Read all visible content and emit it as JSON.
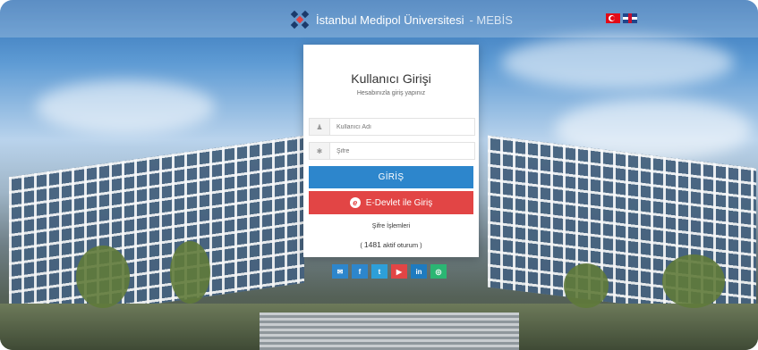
{
  "header": {
    "brand_name": "İstanbul Medipol Üniversitesi",
    "brand_suffix": "- MEBİS",
    "languages": [
      "tr-flag-icon",
      "en-flag-icon"
    ]
  },
  "login": {
    "title": "Kullanıcı Girişi",
    "subtitle": "Hesabınızla giriş yapınız",
    "username_placeholder": "Kullanıcı Adı",
    "password_placeholder": "Şifre",
    "login_button": "GİRİŞ",
    "edevlet_button": "E-Devlet ile Giriş",
    "password_ops": "Şifre İşlemleri",
    "active_prefix": "( ",
    "active_count": "1481",
    "active_suffix": " aktif oturum )"
  },
  "social": [
    {
      "icon": "mail-icon",
      "glyph": "✉",
      "color": "#2d86cc"
    },
    {
      "icon": "facebook-icon",
      "glyph": "f",
      "color": "#2d86cc"
    },
    {
      "icon": "twitter-icon",
      "glyph": "t",
      "color": "#2d9fd9"
    },
    {
      "icon": "youtube-icon",
      "glyph": "▶",
      "color": "#e24545"
    },
    {
      "icon": "linkedin-icon",
      "glyph": "in",
      "color": "#1f7bbf"
    },
    {
      "icon": "instagram-icon",
      "glyph": "◎",
      "color": "#2bb673"
    }
  ],
  "colors": {
    "primary": "#2d86cc",
    "danger": "#e24545"
  }
}
